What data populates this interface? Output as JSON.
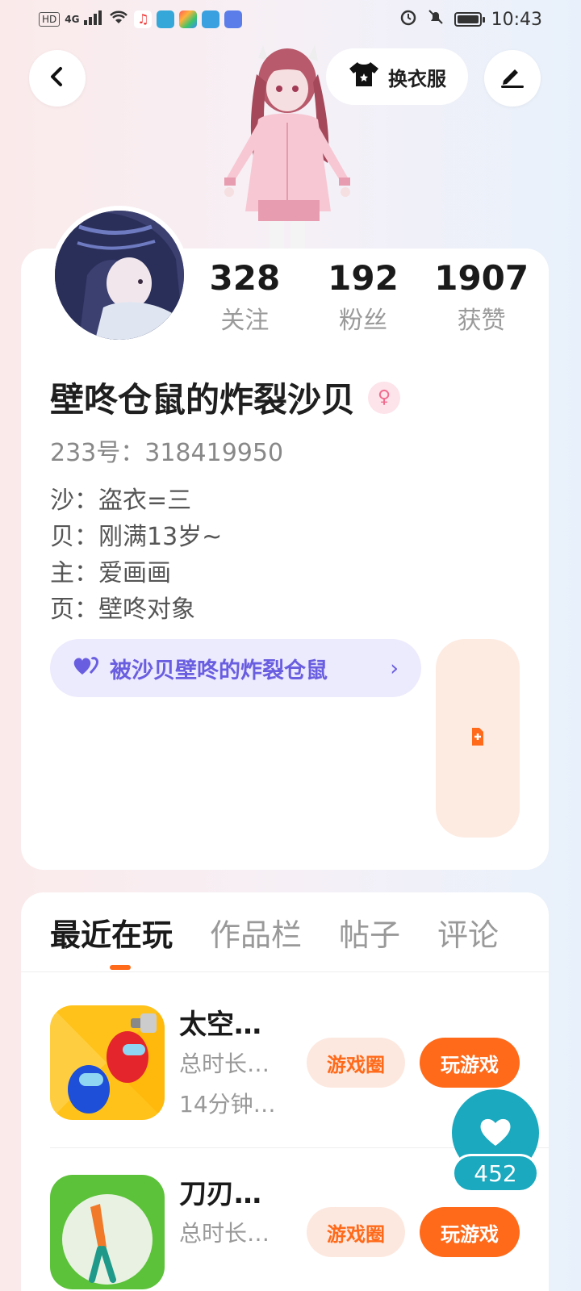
{
  "status_bar": {
    "left_badges": [
      "HD",
      "4G"
    ],
    "time": "10:43"
  },
  "header": {
    "wardrobe_label": "换衣服"
  },
  "profile": {
    "stats": [
      {
        "value": "328",
        "label": "关注"
      },
      {
        "value": "192",
        "label": "粉丝"
      },
      {
        "value": "1907",
        "label": "获赞"
      }
    ],
    "username": "壁咚仓鼠的炸裂沙贝",
    "gender_symbol": "♀",
    "uid": "233号：318419950",
    "bio": [
      "沙：盗衣=三",
      "贝：刚满13岁~",
      "主：爱画画",
      "页：壁咚对象"
    ],
    "relation_label": "被沙贝壁咚的炸裂仓鼠",
    "relation_arrow": "›"
  },
  "tabs": [
    {
      "label": "最近在玩",
      "active": true
    },
    {
      "label": "作品栏",
      "active": false
    },
    {
      "label": "帖子",
      "active": false
    },
    {
      "label": "评论",
      "active": false
    }
  ],
  "games": [
    {
      "title": "太空…",
      "meta1": "总时长…",
      "meta2": "14分钟…",
      "circle_label": "游戏圈",
      "play_label": "玩游戏"
    },
    {
      "title": "刀刃…",
      "meta1": "总时长…",
      "meta2": "",
      "circle_label": "游戏圈",
      "play_label": "玩游戏"
    }
  ],
  "like": {
    "count": "452"
  },
  "colors": {
    "accent": "#ff6a1a",
    "relation": "#6a5ee0",
    "like_fab": "#1aa9bf"
  }
}
